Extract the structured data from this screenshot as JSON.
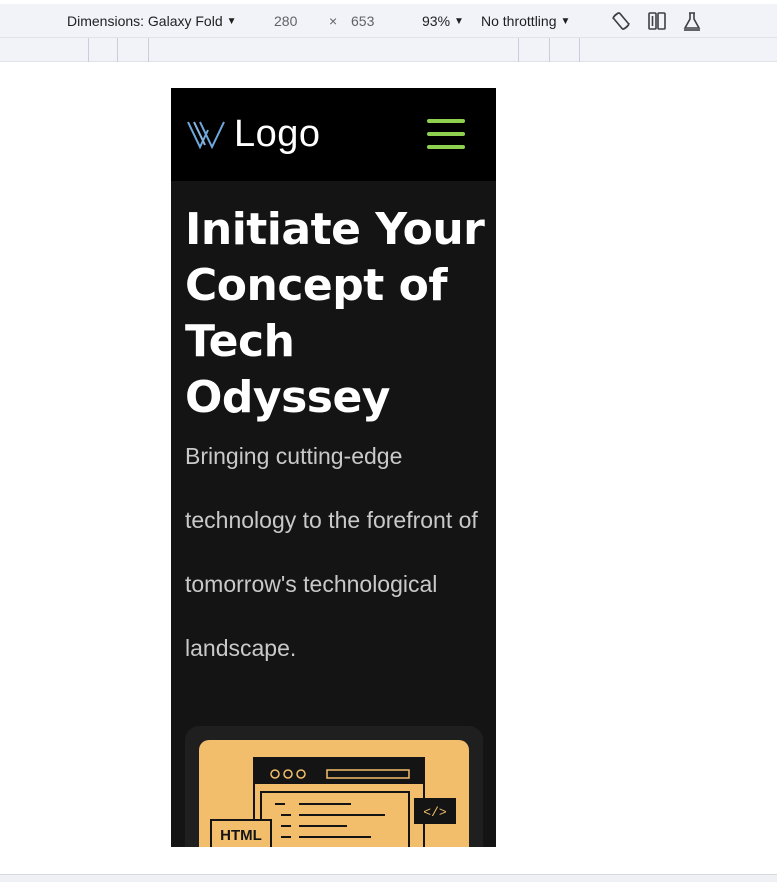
{
  "devtools": {
    "device_label": "Dimensions: Galaxy Fold",
    "width": "280",
    "times": "×",
    "height": "653",
    "zoom": "93%",
    "throttling": "No throttling",
    "icons": [
      "rotate-icon",
      "dual-screen-icon",
      "sensor-flask-icon"
    ]
  },
  "site": {
    "logo_text": "Logo",
    "menu_icon": "hamburger-menu-icon",
    "hero_title": "Initiate Your Concept of Tech Odyssey",
    "hero_subtitle": "Bringing cutting-edge technology to the forefront of tomorrow's technological landscape.",
    "card": {
      "label_html": "HTML",
      "code_tag": "</>",
      "dots": "ooo"
    }
  },
  "colors": {
    "header_bg": "#000000",
    "page_bg": "#141414",
    "accent_green": "#8fd14f",
    "logo_blue": "#6fa8dc",
    "illustration_bg": "#f3be6b"
  }
}
